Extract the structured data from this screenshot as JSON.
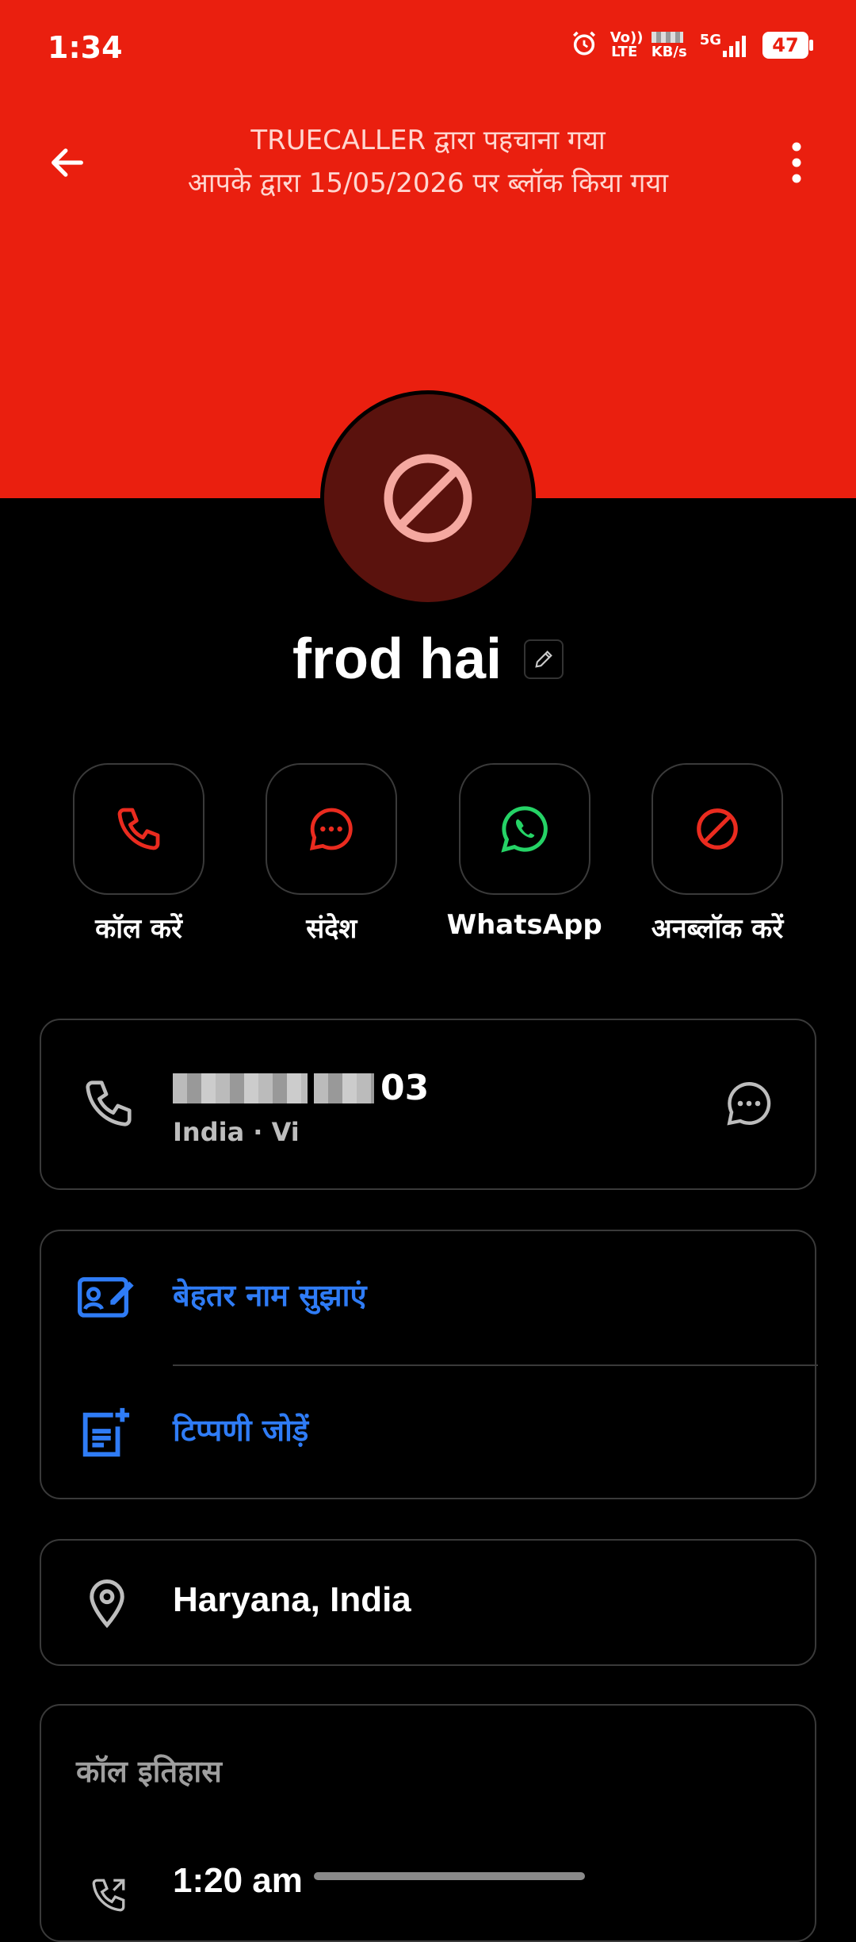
{
  "status": {
    "time": "1:34",
    "volte": "Vo)) LTE",
    "speed_unit": "KB/s",
    "network": "5G",
    "battery": "47"
  },
  "header": {
    "line1": "TRUECALLER द्वारा पहचाना गया",
    "line2": "आपके द्वारा 15/05/2026 पर ब्लॉक किया गया",
    "back_icon": "back-arrow-icon",
    "menu_icon": "more-vertical-icon"
  },
  "contact": {
    "name": "frod hai",
    "avatar_icon": "blocked-icon"
  },
  "actions": [
    {
      "label": "कॉल करें",
      "icon": "phone-icon",
      "color": "#ea2b1f"
    },
    {
      "label": "संदेश",
      "icon": "message-icon",
      "color": "#ea2b1f"
    },
    {
      "label": "WhatsApp",
      "icon": "whatsapp-icon",
      "color": "#25d366"
    },
    {
      "label": "अनब्लॉक करें",
      "icon": "block-icon",
      "color": "#ea2b1f"
    }
  ],
  "phone": {
    "number_visible": "03",
    "sub": "India · Vi"
  },
  "options": [
    {
      "label": "बेहतर नाम सुझाएं",
      "icon": "suggest-name-icon"
    },
    {
      "label": "टिप्पणी जोड़ें",
      "icon": "add-note-icon"
    }
  ],
  "location": {
    "label": "Haryana, India"
  },
  "history": {
    "title": "कॉल इतिहास",
    "entries": [
      {
        "time": "1:20 am"
      }
    ]
  },
  "colors": {
    "header_red": "#ea1f0f",
    "accent_blue": "#2f7cf6"
  }
}
